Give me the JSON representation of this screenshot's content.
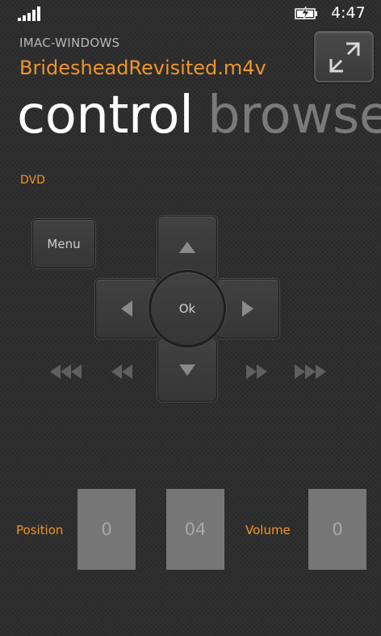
{
  "status_bar": {
    "time": "4:47"
  },
  "header": {
    "device_name": "IMAC-WINDOWS",
    "file_name": "BridesheadRevisited.m4v"
  },
  "pivot": {
    "tabs": [
      {
        "label": "control",
        "selected": true
      },
      {
        "label": "browse",
        "selected": false
      }
    ]
  },
  "section": {
    "label": "DVD"
  },
  "remote": {
    "menu_label": "Menu",
    "ok_label": "Ok"
  },
  "bottom": {
    "position_label": "Position",
    "position_minutes": "0",
    "position_seconds": "04",
    "volume_label": "Volume",
    "volume_value": "0"
  },
  "colors": {
    "accent": "#f0962a",
    "background": "#2b2b2b",
    "value_box": "#767676"
  }
}
